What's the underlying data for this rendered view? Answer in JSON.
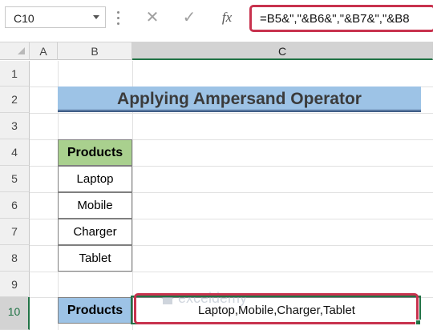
{
  "formula_bar": {
    "name_box": "C10",
    "cancel_icon": "close-icon",
    "enter_icon": "check-icon",
    "fx_label": "fx",
    "formula": "=B5&\",\"&B6&\",\"&B7&\",\"&B8"
  },
  "columns": [
    "A",
    "B",
    "C"
  ],
  "rows": [
    "1",
    "2",
    "3",
    "4",
    "5",
    "6",
    "7",
    "8",
    "9",
    "10"
  ],
  "sheet": {
    "title": "Applying Ampersand Operator",
    "table_header": "Products",
    "products": [
      "Laptop",
      "Mobile",
      "Charger",
      "Tablet"
    ],
    "result_label": "Products",
    "result_value": "Laptop,Mobile,Charger,Tablet"
  },
  "watermark": {
    "text": "exceldemy"
  },
  "colors": {
    "title_fill": "#9dc3e6",
    "header_fill": "#a9d08e",
    "highlight_border": "#c8324e",
    "selection_border": "#217346"
  }
}
